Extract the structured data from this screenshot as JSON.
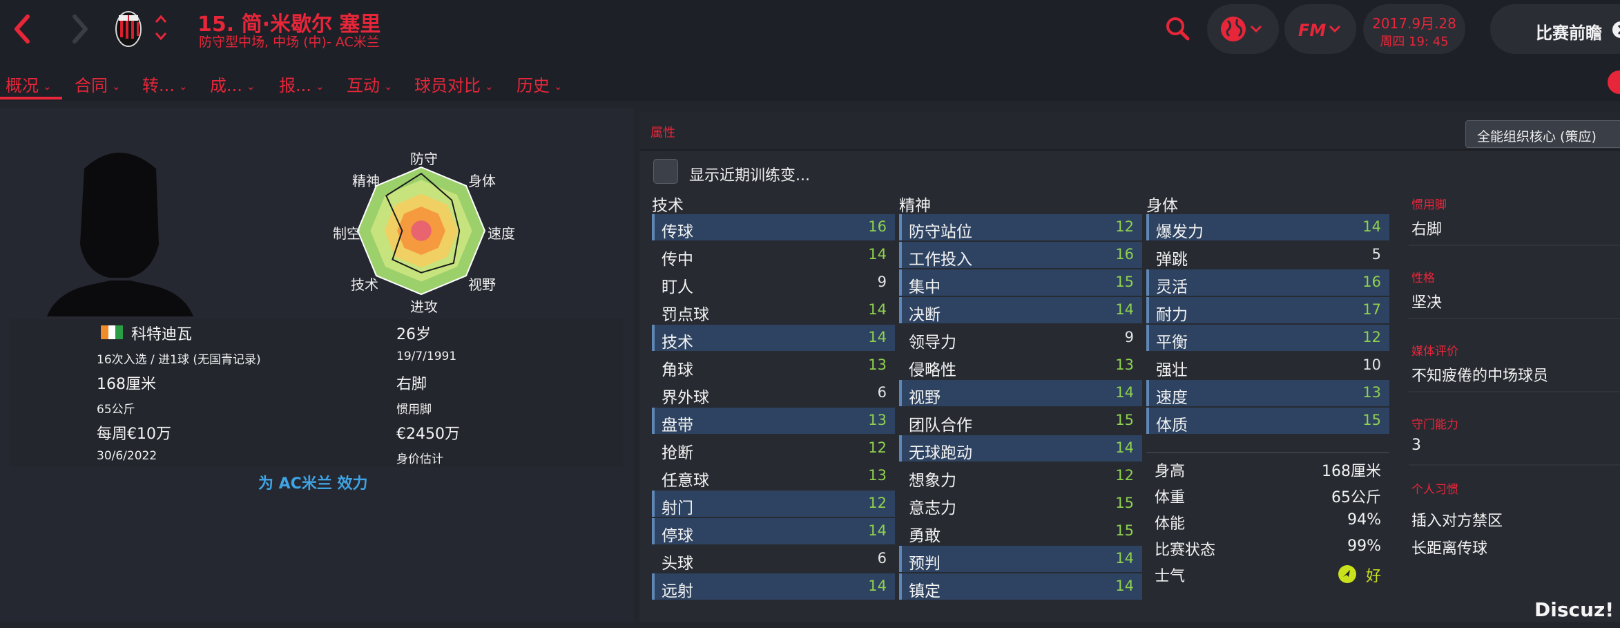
{
  "header": {
    "player_title": "15. 简·米歇尔 塞里",
    "player_subtitle": "防守型中场, 中场 (中)- AC米兰",
    "date_line1": "2017.9月.28",
    "date_line2": "周四 19: 45",
    "match_button": "比赛前瞻",
    "fm_logo": "FM"
  },
  "tabs": [
    {
      "label": "概况"
    },
    {
      "label": "合同"
    },
    {
      "label": "转..."
    },
    {
      "label": "成..."
    },
    {
      "label": "报..."
    },
    {
      "label": "互动"
    },
    {
      "label": "球员对比"
    },
    {
      "label": "历史"
    }
  ],
  "radar": {
    "labels": [
      "防守",
      "身体",
      "速度",
      "视野",
      "进攻",
      "技术",
      "制空",
      "精神"
    ],
    "levels": [
      0.9,
      0.68,
      0.6,
      0.72,
      0.66,
      0.64,
      0.3,
      0.78
    ],
    "colors": [
      "#9bd06b",
      "#c7e37d",
      "#f0d063",
      "#f59a3e",
      "#e8646e"
    ]
  },
  "profile": {
    "nationality": "科特迪瓦",
    "caps": "16次入选 / 进1球 (无国青记录)",
    "height": "168厘米",
    "weight": "65公斤",
    "wage": "每周€10万",
    "contract_end": "30/6/2022",
    "age": "26岁",
    "dob": "19/7/1991",
    "foot": "右脚",
    "foot_label": "惯用脚",
    "value": "€2450万",
    "value_label": "身价估计",
    "plays_for": "为 AC米兰 效力"
  },
  "attributes": {
    "title": "属性",
    "role_button": "全能组织核心 (策应)",
    "training_toggle": "显示近期训练变...",
    "technical_title": "技术",
    "mental_title": "精神",
    "physical_title": "身体",
    "technical": [
      {
        "name": "传球",
        "value": "16",
        "hl": true
      },
      {
        "name": "传中",
        "value": "14",
        "hl": false
      },
      {
        "name": "盯人",
        "value": "9",
        "hl": false
      },
      {
        "name": "罚点球",
        "value": "14",
        "hl": false
      },
      {
        "name": "技术",
        "value": "14",
        "hl": true
      },
      {
        "name": "角球",
        "value": "13",
        "hl": false
      },
      {
        "name": "界外球",
        "value": "6",
        "hl": false
      },
      {
        "name": "盘带",
        "value": "13",
        "hl": true
      },
      {
        "name": "抢断",
        "value": "12",
        "hl": false
      },
      {
        "name": "任意球",
        "value": "13",
        "hl": false
      },
      {
        "name": "射门",
        "value": "12",
        "hl": true
      },
      {
        "name": "停球",
        "value": "14",
        "hl": true
      },
      {
        "name": "头球",
        "value": "6",
        "hl": false
      },
      {
        "name": "远射",
        "value": "14",
        "hl": true
      }
    ],
    "mental": [
      {
        "name": "防守站位",
        "value": "12",
        "hl": true
      },
      {
        "name": "工作投入",
        "value": "16",
        "hl": true
      },
      {
        "name": "集中",
        "value": "15",
        "hl": true
      },
      {
        "name": "决断",
        "value": "14",
        "hl": true
      },
      {
        "name": "领导力",
        "value": "9",
        "hl": false
      },
      {
        "name": "侵略性",
        "value": "13",
        "hl": false
      },
      {
        "name": "视野",
        "value": "14",
        "hl": true
      },
      {
        "name": "团队合作",
        "value": "15",
        "hl": false
      },
      {
        "name": "无球跑动",
        "value": "14",
        "hl": true
      },
      {
        "name": "想象力",
        "value": "12",
        "hl": false
      },
      {
        "name": "意志力",
        "value": "15",
        "hl": false
      },
      {
        "name": "勇敢",
        "value": "15",
        "hl": false
      },
      {
        "name": "预判",
        "value": "14",
        "hl": true
      },
      {
        "name": "镇定",
        "value": "14",
        "hl": true
      }
    ],
    "physical": [
      {
        "name": "爆发力",
        "value": "14",
        "hl": true
      },
      {
        "name": "弹跳",
        "value": "5",
        "hl": false
      },
      {
        "name": "灵活",
        "value": "16",
        "hl": true
      },
      {
        "name": "耐力",
        "value": "17",
        "hl": true
      },
      {
        "name": "平衡",
        "value": "12",
        "hl": true
      },
      {
        "name": "强壮",
        "value": "10",
        "hl": false
      },
      {
        "name": "速度",
        "value": "13",
        "hl": true
      },
      {
        "name": "体质",
        "value": "15",
        "hl": true
      }
    ],
    "stats": [
      {
        "name": "身高",
        "value": "168厘米"
      },
      {
        "name": "体重",
        "value": "65公斤"
      },
      {
        "name": "体能",
        "value": "94%"
      },
      {
        "name": "比赛状态",
        "value": "99%"
      },
      {
        "name": "士气",
        "value": "好"
      }
    ]
  },
  "side": [
    {
      "label": "惯用脚",
      "value": "右脚"
    },
    {
      "label": "性格",
      "value": "坚决"
    },
    {
      "label": "媒体评价",
      "value": "不知疲倦的中场球员"
    },
    {
      "label": "守门能力",
      "value": "3"
    },
    {
      "label": "个人习惯",
      "value": "插入对方禁区",
      "value2": "长距离传球"
    }
  ],
  "watermark": "Discuz!",
  "colors": {
    "accent": "#e8263a",
    "value_green": "#8fd14f",
    "link_blue": "#3fa4e6"
  }
}
